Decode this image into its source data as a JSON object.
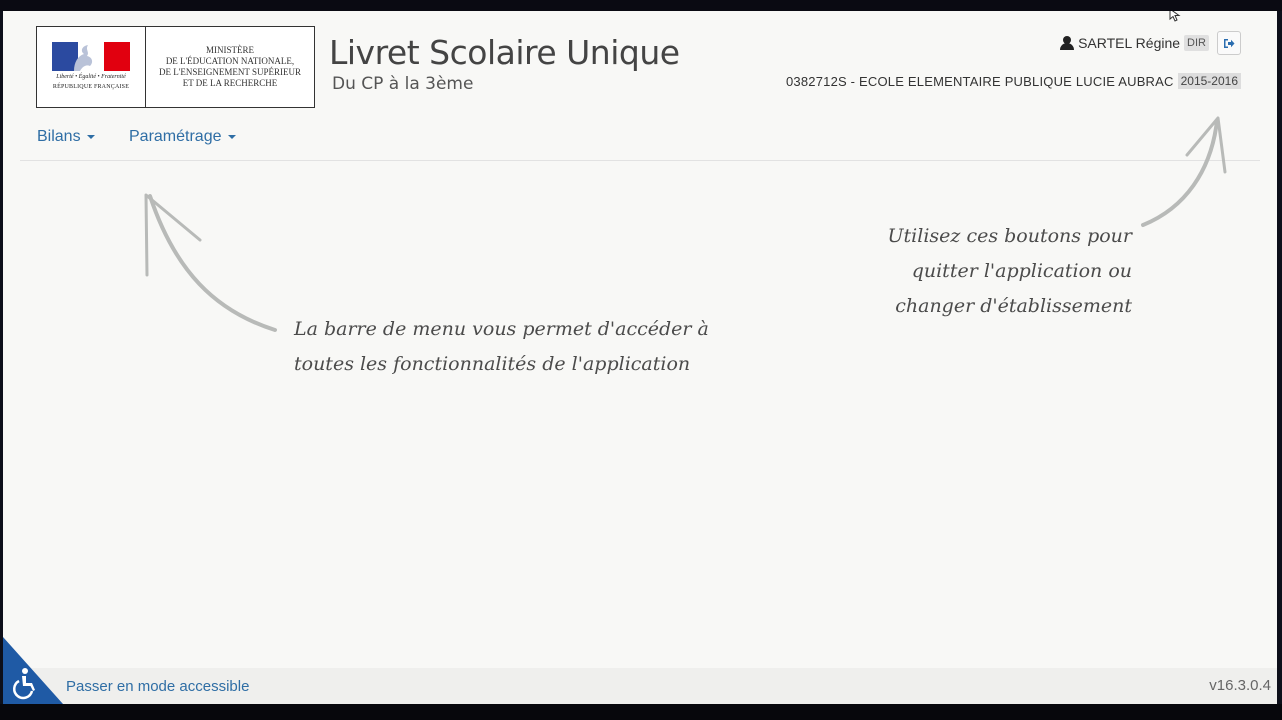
{
  "logo": {
    "motto": "Liberté • Égalité • Fraternité",
    "republic": "RÉPUBLIQUE FRANÇAISE",
    "ministry_lines": [
      "MINISTÈRE",
      "DE L'ÉDUCATION NATIONALE,",
      "DE L'ENSEIGNEMENT SUPÉRIEUR",
      "ET DE LA RECHERCHE"
    ]
  },
  "header": {
    "title": "Livret Scolaire Unique",
    "subtitle": "Du CP à la 3ème",
    "user_name": "SARTEL Régine",
    "role": "DIR",
    "school": "0382712S - ECOLE ELEMENTAIRE PUBLIQUE LUCIE AUBRAC",
    "year": "2015-2016",
    "logout_icon": "sign-out-icon",
    "user_icon": "user-icon"
  },
  "nav": {
    "items": [
      {
        "label": "Bilans"
      },
      {
        "label": "Paramétrage"
      }
    ]
  },
  "hints": {
    "menu": [
      "La barre de menu vous permet d'accéder à",
      "toutes les fonctionnalités de l'application"
    ],
    "buttons": [
      "Utilisez ces boutons pour",
      "quitter l'application ou",
      "changer d'établissement"
    ]
  },
  "footer": {
    "accessible_label": "Passer en mode accessible",
    "version": "v16.3.0.4",
    "accessibility_icon": "wheelchair-icon"
  },
  "colors": {
    "link": "#2f6ea5",
    "accessibility_corner": "#1f5aa5",
    "flag_blue": "#2b4aa0",
    "flag_red": "#e1000f"
  }
}
